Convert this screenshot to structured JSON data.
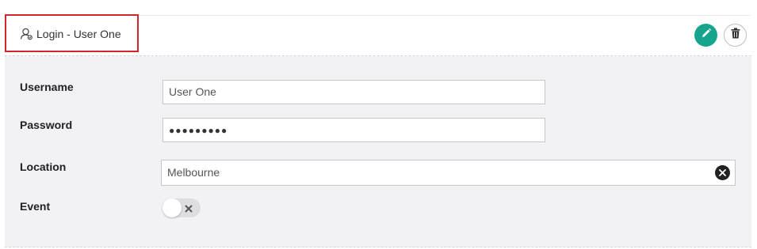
{
  "header": {
    "title": "Login - User One",
    "user_icon": "user-icon",
    "edit_icon": "pencil-icon",
    "delete_icon": "trash-icon",
    "accent_color": "#16a58c",
    "highlight_color": "#d1262b"
  },
  "form": {
    "username": {
      "label": "Username",
      "value": "User One"
    },
    "password": {
      "label": "Password",
      "value": "●●●●●●●●●"
    },
    "location": {
      "label": "Location",
      "value": "Melbourne",
      "clear_icon": "close-circle-icon"
    },
    "event": {
      "label": "Event",
      "enabled": false,
      "toggle_icon": "x-icon"
    }
  }
}
